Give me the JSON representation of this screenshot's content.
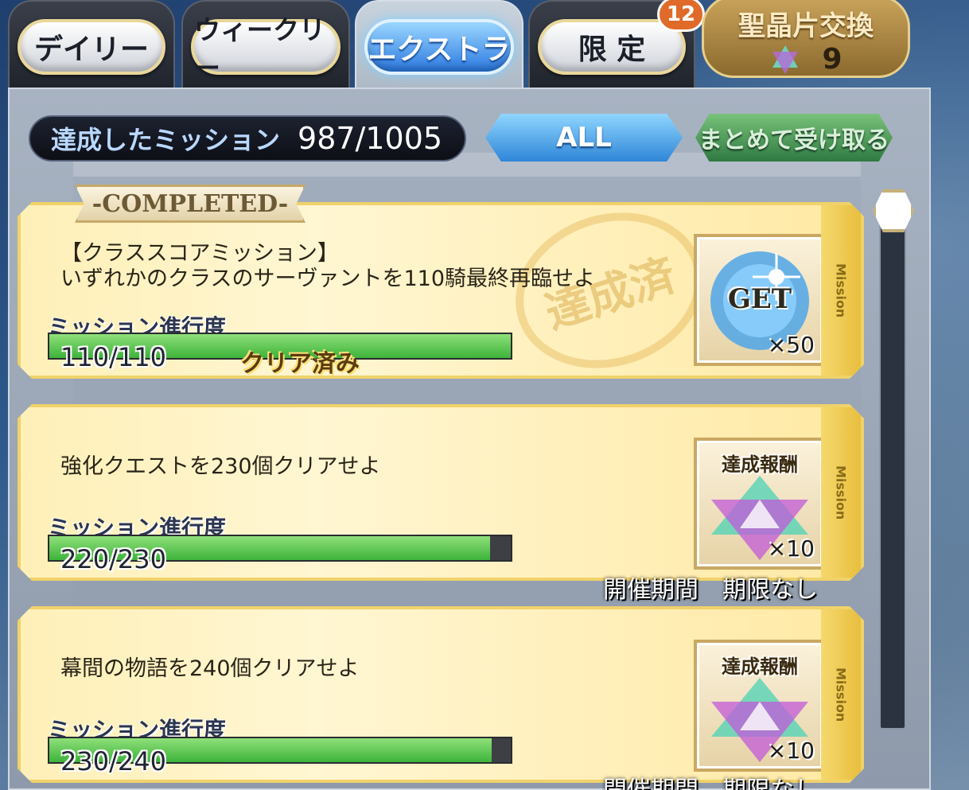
{
  "tabs": [
    {
      "label": "デイリー",
      "active": false
    },
    {
      "label": "ウィークリー",
      "active": false
    },
    {
      "label": "エクストラ",
      "active": true
    },
    {
      "label": "限 定",
      "active": false
    }
  ],
  "limited_badge": "12",
  "exchange": {
    "label": "聖晶片交換",
    "count": "9"
  },
  "header": {
    "achieved_label": "達成したミッション",
    "achieved_value": "987/1005",
    "filter_label": "ALL",
    "collect_label": "まとめて受け取る"
  },
  "completed_ribbon": "-COMPLETED-",
  "missions": [
    {
      "title_line1": "【クラススコアミッション】",
      "title_line2": "いずれかのクラスのサーヴァントを110騎最終再臨せよ",
      "progress_label": "ミッション進行度",
      "progress_value": "110/110",
      "progress_fraction": 1.0,
      "status": "クリア済み",
      "stamp": "達成済",
      "reward_title": "GET",
      "reward_qty": "×50",
      "side_label": "Mission"
    },
    {
      "title_line1": "強化クエストを230個クリアせよ",
      "progress_label": "ミッション進行度",
      "progress_value": "220/230",
      "progress_fraction": 0.956,
      "reward_title": "達成報酬",
      "reward_qty": "×10",
      "period": "開催期間　期限なし",
      "side_label": "Mission"
    },
    {
      "title_line1": "幕間の物語を240個クリアせよ",
      "progress_label": "ミッション進行度",
      "progress_value": "230/240",
      "progress_fraction": 0.958,
      "reward_title": "達成報酬",
      "reward_qty": "×10",
      "period": "開催期間　期限なし",
      "side_label": "Mission"
    }
  ],
  "colors": {
    "active_tab": "#2a78e0",
    "progress_green": "#3db33a",
    "card_gold": "#f0d26a"
  }
}
